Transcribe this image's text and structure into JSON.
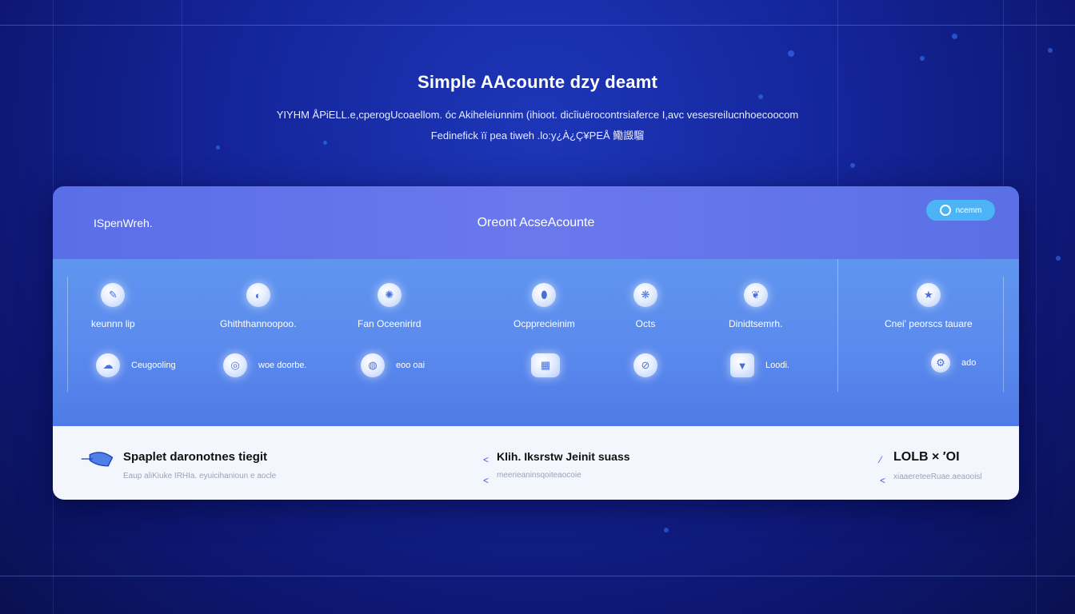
{
  "hero": {
    "title": "Simple AAcounte dzy deamt",
    "line1": "YIYHM ÅPiELL.e,cperogUcoaellom. óc Akiheleiunnim (ihioot. dicîiuërocontrsiaferce I,avc vesesreilucnhoecoocom",
    "line2": "Fedinefick ïï pea tiweh .lo:y¿À¿Ç¥PEÅ 鰳譭騮"
  },
  "panel": {
    "left_label": "ISpenWreh.",
    "title": "Oreont AcseAcounte",
    "pill_label": "ncemm",
    "features_row1": [
      {
        "label": "keunnn lip",
        "icon": "pencil-icon"
      },
      {
        "label": "Ghiththannoopoo.",
        "icon": "lemon-icon"
      },
      {
        "label": "Fan Oceenirird",
        "icon": "brain-icon"
      },
      {
        "label": "Ocpprecieinim",
        "icon": "shield-icon"
      },
      {
        "label": "Octs",
        "icon": "shell-icon"
      },
      {
        "label": "Dinidtsemrh.",
        "icon": "leaf-icon"
      },
      {
        "label": "Cnei' peorscs tauare",
        "icon": "star-icon"
      }
    ],
    "features_row2": [
      {
        "label": "Ceugooling",
        "icon": "cloud-icon"
      },
      {
        "label": "woe doorbe.",
        "icon": "ring-icon"
      },
      {
        "label": "eoo    oai",
        "icon": "globe-icon"
      },
      {
        "label": "",
        "icon": "keyboard-icon"
      },
      {
        "label": "",
        "icon": "compass-icon"
      },
      {
        "label": "Loodi.",
        "icon": "cup-icon"
      },
      {
        "label": "ado",
        "icon": "gear-icon"
      }
    ]
  },
  "footer": [
    {
      "title": "Spaplet daronotnes tiegit",
      "sub": "Eaup aliKiuke IRHIa. eyuicihanioun e aocle",
      "icon": "plane-icon"
    },
    {
      "title": "Klih. Iksrstw Jeinit suass",
      "sub": "meerieaninsqoiteaocoie",
      "icon": "arrow-icon"
    },
    {
      "title": "LOLB × ′OI",
      "sub": "xiaaereteeRuae.aeaooisl",
      "icon": "feather-icon"
    }
  ],
  "colors": {
    "accent": "#4cb4f6",
    "panel_head": "#6574ea",
    "panel_body": "#5b8bee",
    "footer_bg": "#f3f6fd"
  }
}
